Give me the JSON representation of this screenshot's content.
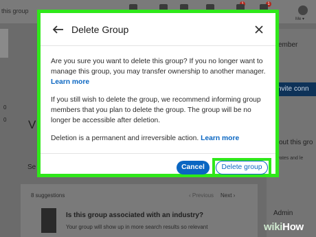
{
  "background": {
    "breadcrumb": "this group",
    "notification_badges": [
      "1",
      "1"
    ],
    "me_label": "Me ▾",
    "left_numbers": [
      "0",
      "0"
    ],
    "group_initial": "V",
    "section_partial": "Se",
    "member_partial": "ember",
    "invite_button_partial": "nvite conn",
    "about_partial": "out this gro",
    "activity_partial": "ivates and le",
    "admin_label": "Admin",
    "suggestions": {
      "count_label": "8 suggestions",
      "previous_label": "‹ Previous",
      "next_label": "Next ›",
      "industry_question": "Is this group associated with an industry?",
      "industry_description": "Your group will show up in more search results so relevant"
    }
  },
  "dialog": {
    "title": "Delete Group",
    "paragraph1": "Are you sure you want to delete this group? If you no longer want to manage this group, you may transfer ownership to another manager.",
    "paragraph1_link": "Learn more",
    "paragraph2": "If you still wish to delete the group, we recommend informing group members that you plan to delete the group. The group will be no longer be accessible after deletion.",
    "paragraph3": "Deletion is a permanent and irreversible action.",
    "paragraph3_link": "Learn more",
    "cancel_label": "Cancel",
    "delete_label": "Delete group",
    "icons": [
      "arrow-left",
      "close"
    ]
  },
  "watermark": {
    "part1": "wiki",
    "part2": "How"
  },
  "colors": {
    "highlight": "#2fe81a",
    "primary": "#0a66c2"
  }
}
